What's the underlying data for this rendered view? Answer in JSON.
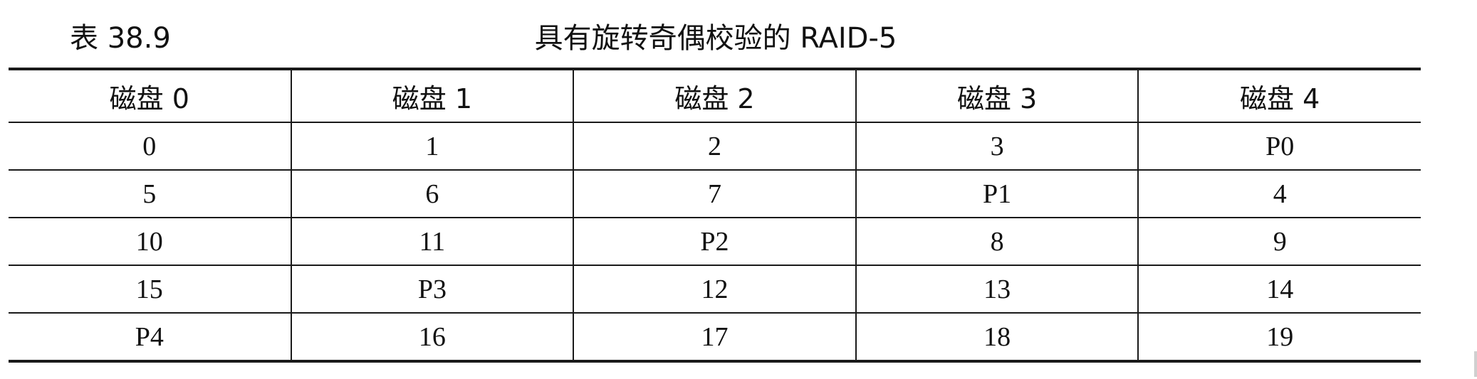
{
  "caption": {
    "number": "表 38.9",
    "title": "具有旋转奇偶校验的 RAID-5"
  },
  "table": {
    "headers": [
      "磁盘 0",
      "磁盘 1",
      "磁盘 2",
      "磁盘 3",
      "磁盘 4"
    ],
    "rows": [
      [
        "0",
        "1",
        "2",
        "3",
        "P0"
      ],
      [
        "5",
        "6",
        "7",
        "P1",
        "4"
      ],
      [
        "10",
        "11",
        "P2",
        "8",
        "9"
      ],
      [
        "15",
        "P3",
        "12",
        "13",
        "14"
      ],
      [
        "P4",
        "16",
        "17",
        "18",
        "19"
      ]
    ]
  }
}
